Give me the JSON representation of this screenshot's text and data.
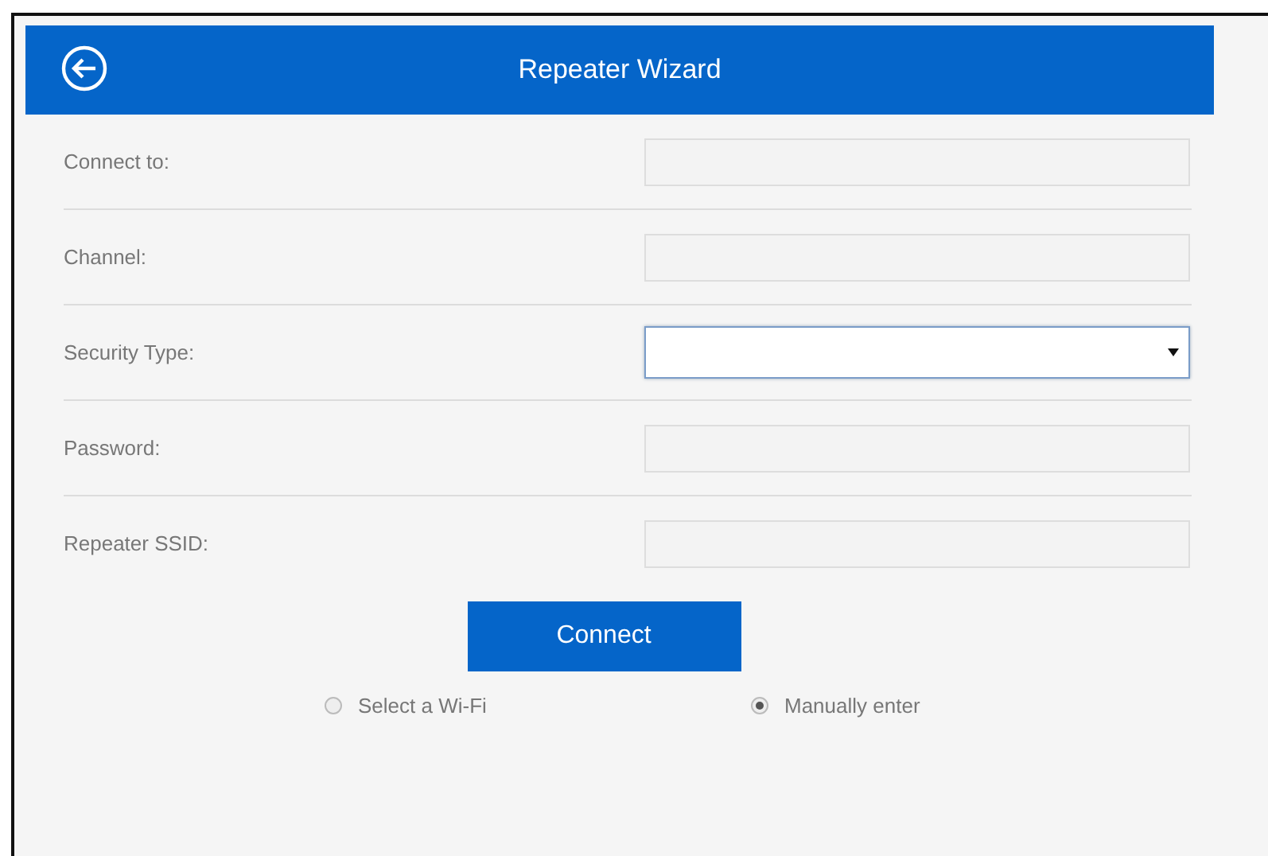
{
  "header": {
    "title": "Repeater Wizard"
  },
  "fields": [
    {
      "label": "Connect to:",
      "kind": "input",
      "focused": false
    },
    {
      "label": "Channel:",
      "kind": "input",
      "focused": false
    },
    {
      "label": "Security Type:",
      "kind": "select",
      "focused": true
    },
    {
      "label": "Password:",
      "kind": "input",
      "focused": false
    },
    {
      "label": "Repeater SSID:",
      "kind": "input",
      "focused": false
    }
  ],
  "connect_button": "Connect",
  "modes": [
    {
      "label": "Select a Wi-Fi",
      "selected": false
    },
    {
      "label": "Manually enter",
      "selected": true
    }
  ]
}
